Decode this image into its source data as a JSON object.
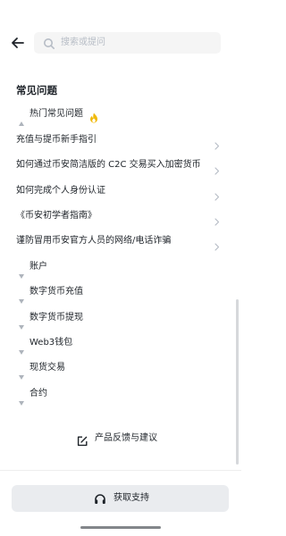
{
  "header": {
    "search_placeholder": "搜索或提问"
  },
  "faq": {
    "section_title": "常见问题",
    "hot_group_label": "热门常见问题",
    "articles": [
      {
        "label": "充值与提币新手指引"
      },
      {
        "label": "如何通过币安简洁版的 C2C 交易买入加密货币"
      },
      {
        "label": "如何完成个人身份认证"
      },
      {
        "label": "《币安初学者指南》"
      },
      {
        "label": "谨防冒用币安官方人员的网络/电话诈骗"
      }
    ],
    "categories": [
      {
        "label": "账户"
      },
      {
        "label": "数字货币充值"
      },
      {
        "label": "数字货币提现"
      },
      {
        "label": "Web3钱包"
      },
      {
        "label": "现货交易"
      },
      {
        "label": "合约"
      }
    ]
  },
  "feedback_label": "产品反馈与建议",
  "support_button_label": "获取支持",
  "colors": {
    "text": "#1e2329",
    "muted": "#b7bdc6",
    "fire": "#f0b90b",
    "button_bg": "#eaecef"
  }
}
